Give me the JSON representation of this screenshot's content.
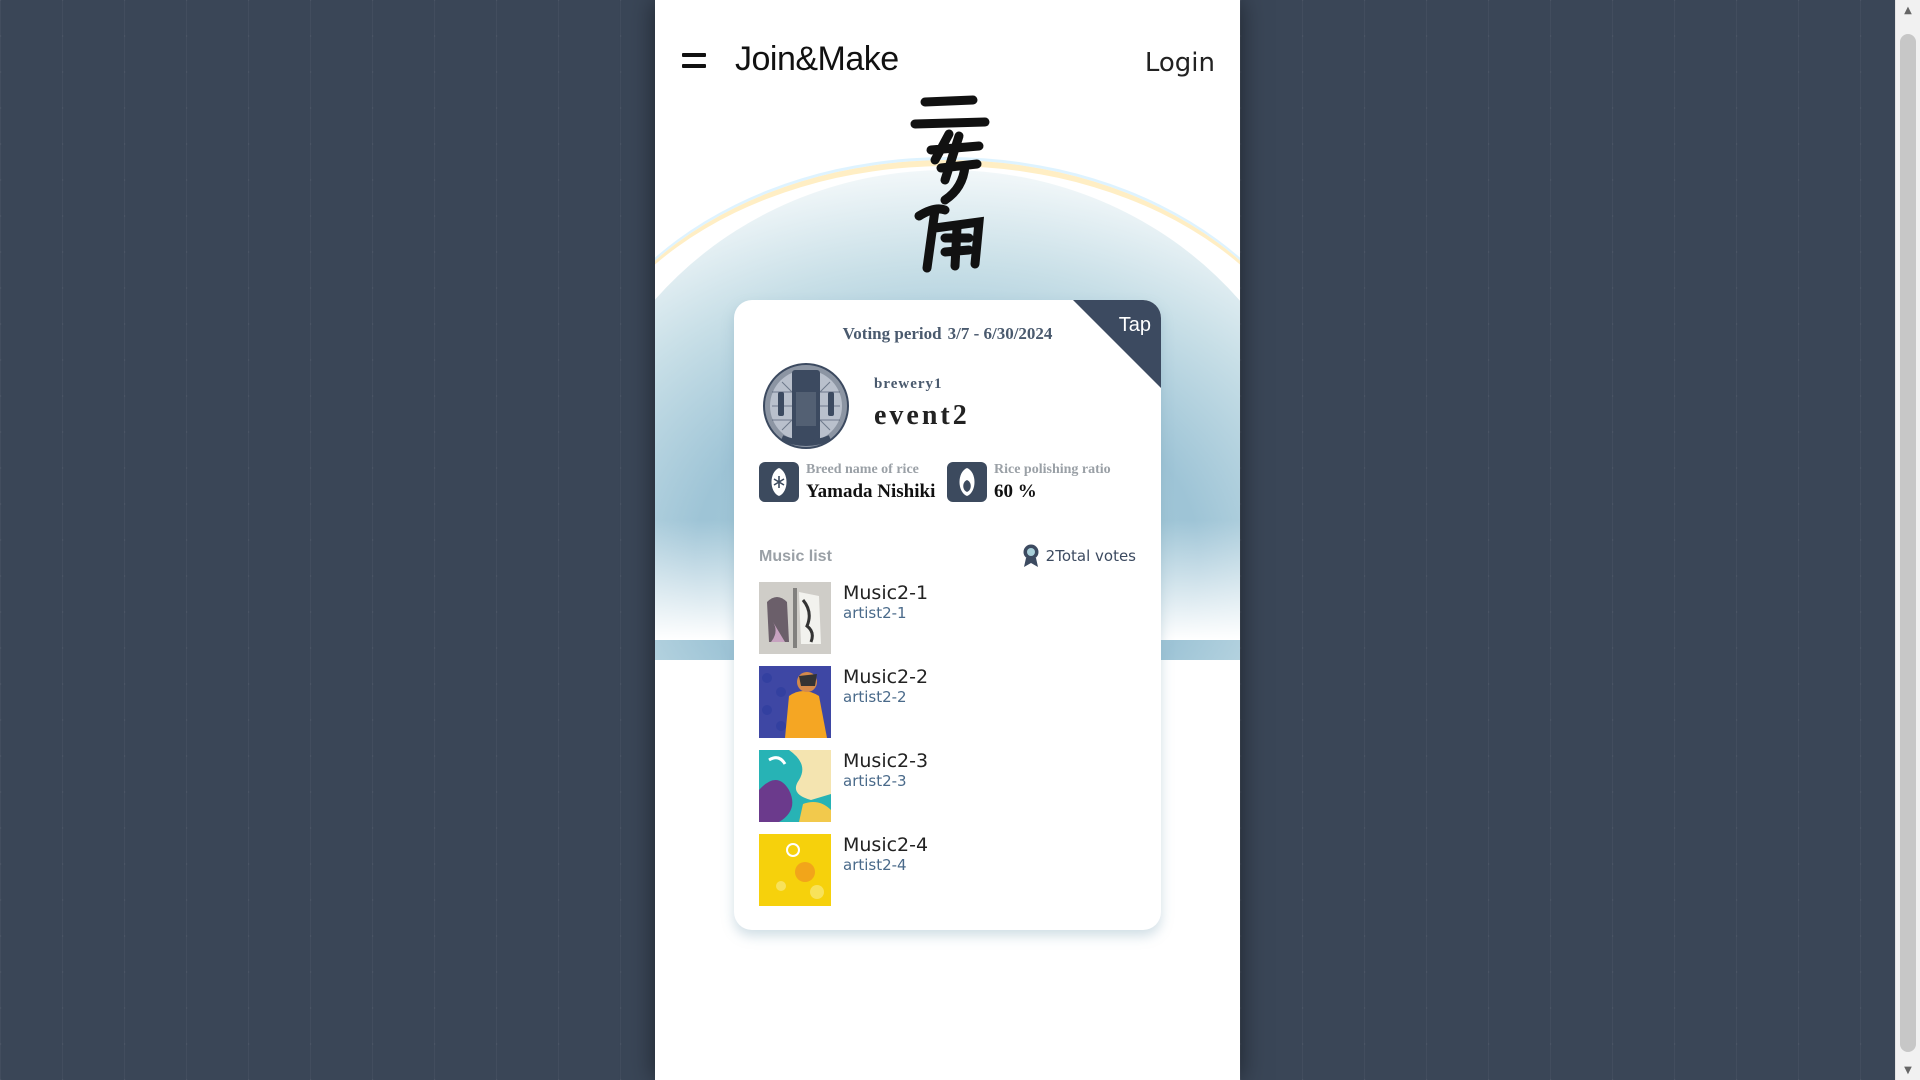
{
  "header": {
    "logo_text": "Join&Make",
    "login_label": "Login"
  },
  "card": {
    "tap_label": "Tap",
    "voting_label": "Voting period",
    "voting_dates": "3/7 - 6/30/2024",
    "brewery": "brewery1",
    "event": "event2",
    "rice_label": "Breed name of rice",
    "rice_value": "Yamada Nishiki",
    "ratio_label": "Rice polishing ratio",
    "ratio_value": "60 %",
    "music_list_label": "Music list",
    "total_votes": "2Total votes"
  },
  "tracks": [
    {
      "title": "Music2-1",
      "artist": "artist2-1"
    },
    {
      "title": "Music2-2",
      "artist": "artist2-2"
    },
    {
      "title": "Music2-3",
      "artist": "artist2-3"
    },
    {
      "title": "Music2-4",
      "artist": "artist2-4"
    }
  ],
  "colors": {
    "page_bg": "#3a4657",
    "accent_dark": "#3c4a60",
    "hero_blue": "#a8cfd9"
  }
}
